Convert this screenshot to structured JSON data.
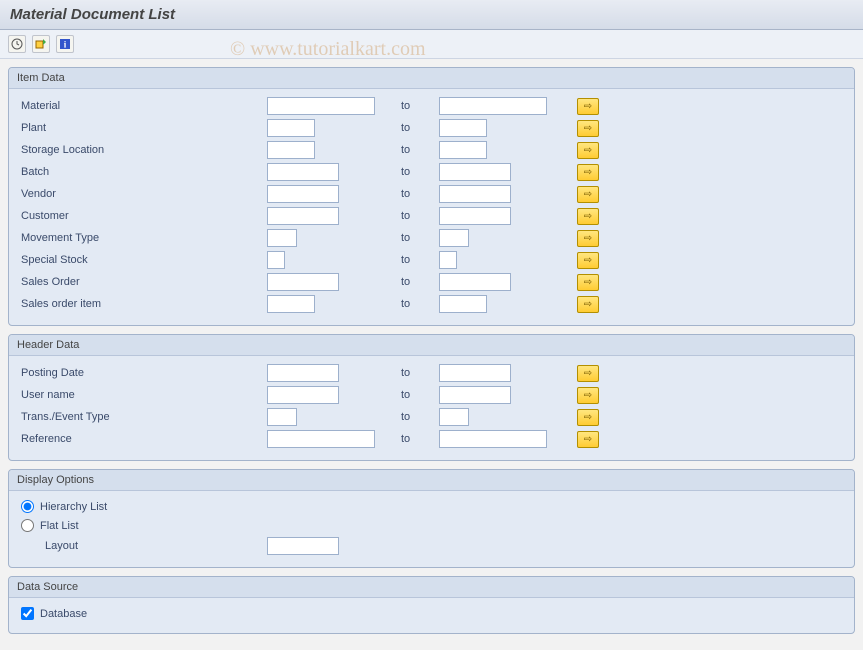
{
  "title": "Material Document List",
  "watermark": "© www.tutorialkart.com",
  "toolbar": {
    "execute_title": "Execute",
    "export_title": "Export",
    "info_title": "Information"
  },
  "sections": {
    "item_data": {
      "title": "Item Data",
      "to_label": "to",
      "fields": {
        "material": "Material",
        "plant": "Plant",
        "storage_location": "Storage Location",
        "batch": "Batch",
        "vendor": "Vendor",
        "customer": "Customer",
        "movement_type": "Movement Type",
        "special_stock": "Special Stock",
        "sales_order": "Sales Order",
        "sales_order_item": "Sales order item"
      }
    },
    "header_data": {
      "title": "Header Data",
      "to_label": "to",
      "fields": {
        "posting_date": "Posting Date",
        "user_name": "User name",
        "trans_event_type": "Trans./Event Type",
        "reference": "Reference"
      }
    },
    "display_options": {
      "title": "Display Options",
      "hierarchy_list": "Hierarchy List",
      "flat_list": "Flat List",
      "layout": "Layout"
    },
    "data_source": {
      "title": "Data Source",
      "database": "Database"
    }
  }
}
